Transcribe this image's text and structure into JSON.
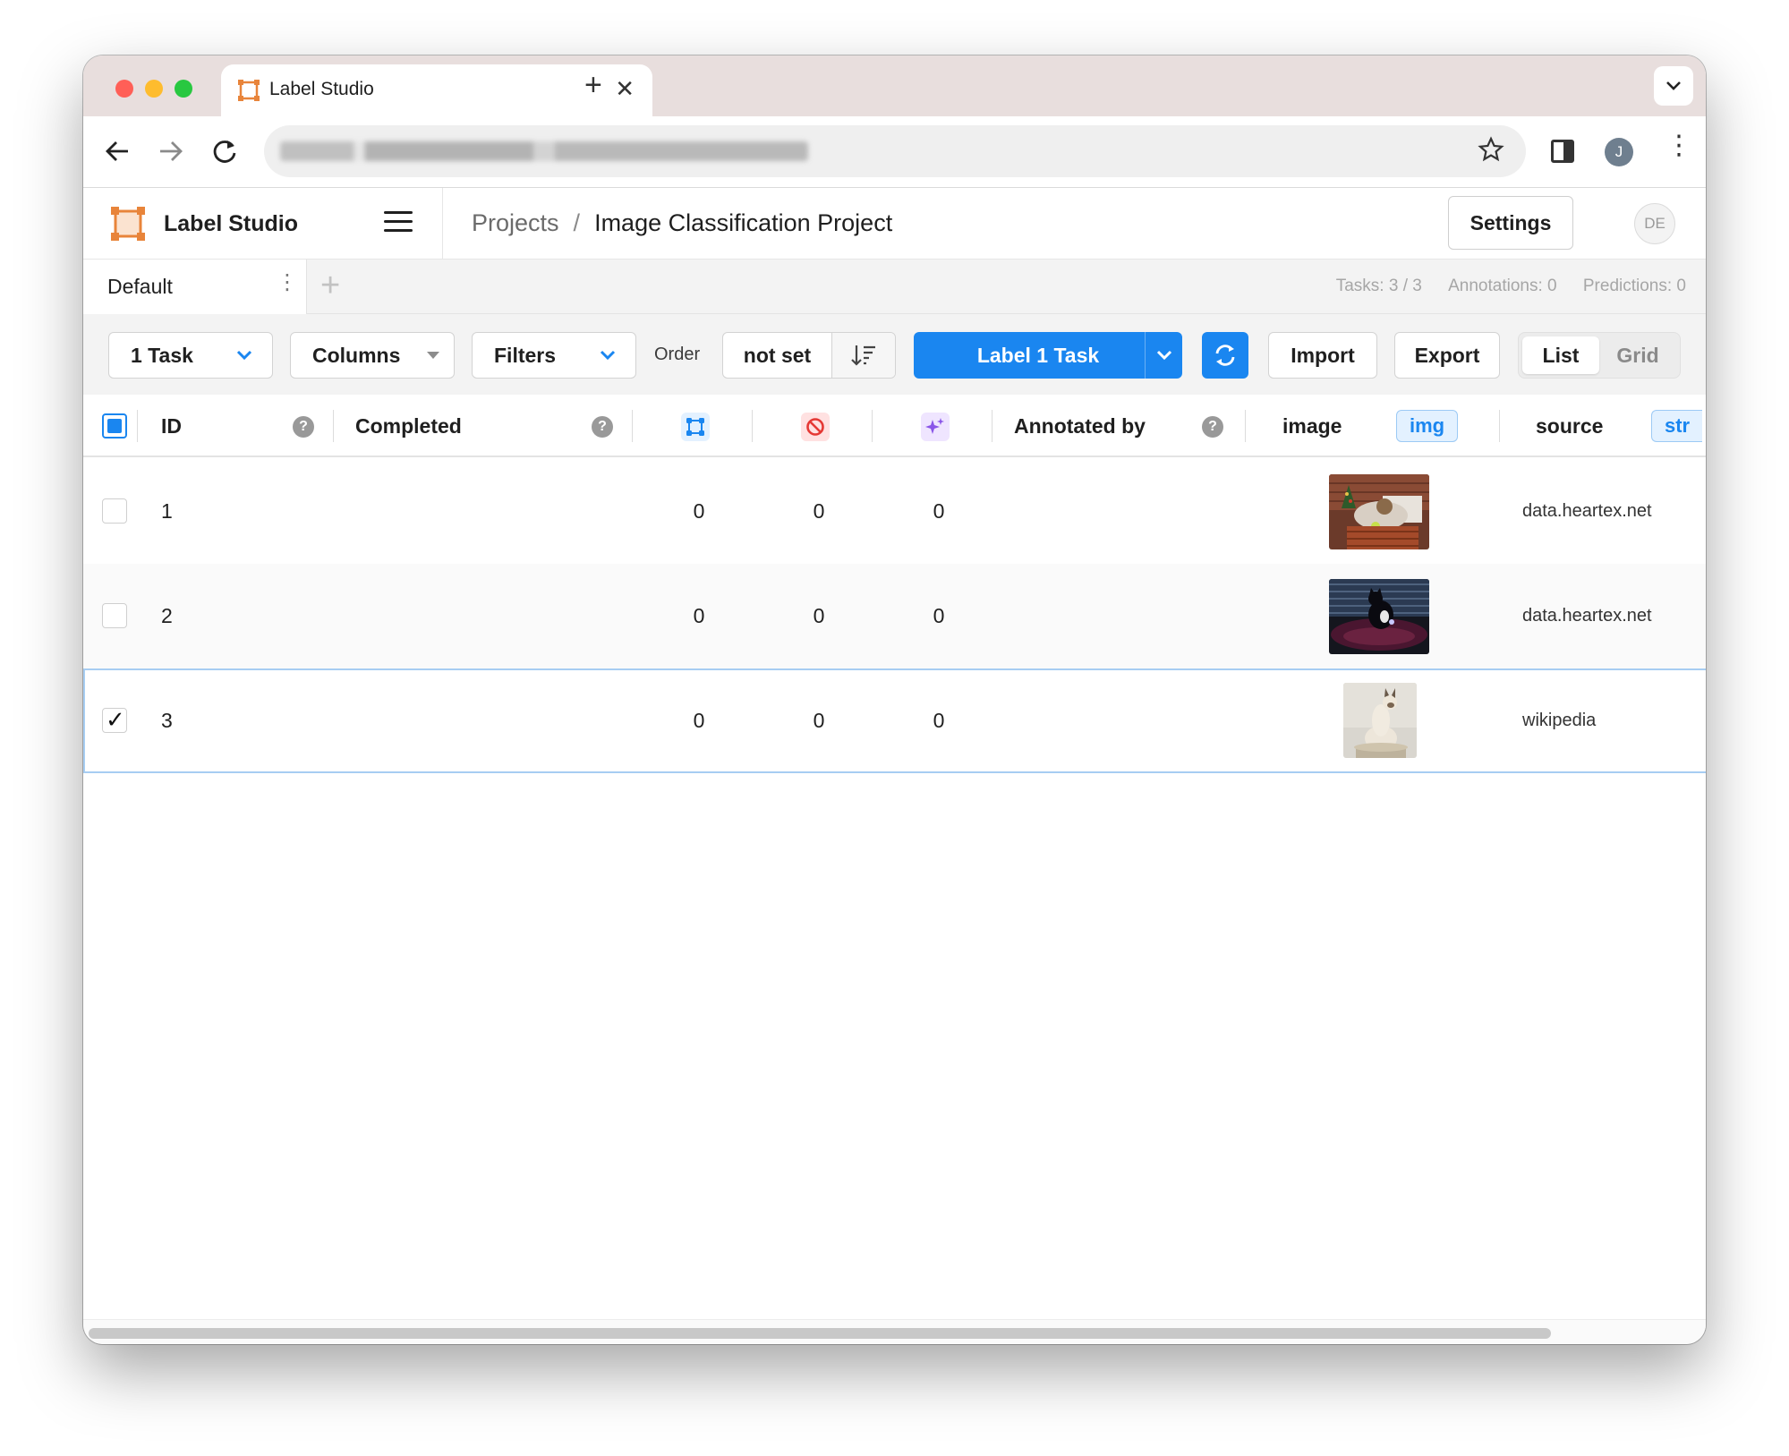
{
  "browser": {
    "tab_title": "Label Studio",
    "tab_close": "✕",
    "new_tab": "+",
    "profile_initial": "J"
  },
  "app": {
    "name": "Label Studio",
    "breadcrumb": {
      "projects": "Projects",
      "separator": "/",
      "project": "Image Classification Project"
    },
    "settings_label": "Settings",
    "user_initials": "DE",
    "accent_color": "#1a86f0",
    "brand_color": "#e8843a"
  },
  "views": {
    "active_tab": "Default",
    "add_view": "+",
    "stats": {
      "tasks": "Tasks: 3 / 3",
      "annotations": "Annotations: 0",
      "predictions": "Predictions: 0"
    }
  },
  "actions": {
    "tasks_button": "1 Task",
    "columns_button": "Columns",
    "filters_button": "Filters",
    "order_label": "Order",
    "order_value": "not set",
    "label_button": "Label 1 Task",
    "import_button": "Import",
    "export_button": "Export",
    "view_modes": [
      "List",
      "Grid"
    ],
    "active_view_mode": "List"
  },
  "table": {
    "columns": {
      "id": "ID",
      "completed": "Completed",
      "total_annotations_icon": "annotations-icon",
      "cancelled_icon": "cancelled-icon",
      "predictions_icon": "predictions-icon",
      "annotated_by": "Annotated by",
      "image": "image",
      "image_type": "img",
      "source": "source",
      "source_type": "str"
    },
    "rows": [
      {
        "id": "1",
        "completed": "",
        "annotations": "0",
        "cancelled": "0",
        "predictions": "0",
        "annotated_by": "",
        "image": "kitten-in-basket",
        "source": "data.heartex.net",
        "checked": false
      },
      {
        "id": "2",
        "completed": "",
        "annotations": "0",
        "cancelled": "0",
        "predictions": "0",
        "annotated_by": "",
        "image": "black-cat-on-rug",
        "source": "data.heartex.net",
        "checked": false
      },
      {
        "id": "3",
        "completed": "",
        "annotations": "0",
        "cancelled": "0",
        "predictions": "0",
        "annotated_by": "",
        "image": "siamese-cat",
        "source": "wikipedia",
        "checked": true
      }
    ]
  }
}
